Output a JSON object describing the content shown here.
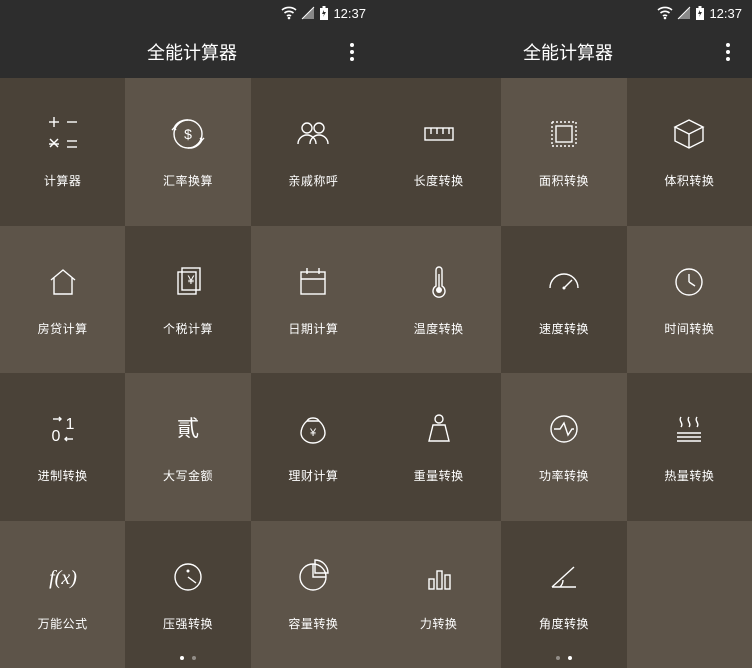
{
  "status": {
    "time": "12:37"
  },
  "app": {
    "title": "全能计算器"
  },
  "screens": [
    {
      "page_index": 0,
      "tiles": [
        {
          "id": "calculator",
          "label": "计算器",
          "icon": "calc"
        },
        {
          "id": "currency",
          "label": "汇率换算",
          "icon": "currency"
        },
        {
          "id": "kinship",
          "label": "亲戚称呼",
          "icon": "people"
        },
        {
          "id": "mortgage",
          "label": "房贷计算",
          "icon": "house"
        },
        {
          "id": "tax",
          "label": "个税计算",
          "icon": "tax"
        },
        {
          "id": "date",
          "label": "日期计算",
          "icon": "calendar"
        },
        {
          "id": "radix",
          "label": "进制转换",
          "icon": "radix"
        },
        {
          "id": "capital",
          "label": "大写金额",
          "icon": "capital"
        },
        {
          "id": "finance",
          "label": "理财计算",
          "icon": "moneybag"
        },
        {
          "id": "formula",
          "label": "万能公式",
          "icon": "fx"
        },
        {
          "id": "pressure",
          "label": "压强转换",
          "icon": "gauge"
        },
        {
          "id": "volume-cap",
          "label": "容量转换",
          "icon": "pie"
        }
      ]
    },
    {
      "page_index": 1,
      "tiles": [
        {
          "id": "length",
          "label": "长度转换",
          "icon": "ruler"
        },
        {
          "id": "area",
          "label": "面积转换",
          "icon": "area"
        },
        {
          "id": "volume",
          "label": "体积转换",
          "icon": "cube"
        },
        {
          "id": "temp",
          "label": "温度转换",
          "icon": "thermo"
        },
        {
          "id": "speed",
          "label": "速度转换",
          "icon": "speed"
        },
        {
          "id": "time",
          "label": "时间转换",
          "icon": "clock"
        },
        {
          "id": "weight",
          "label": "重量转换",
          "icon": "weight"
        },
        {
          "id": "power",
          "label": "功率转换",
          "icon": "power"
        },
        {
          "id": "heat",
          "label": "热量转换",
          "icon": "heat"
        },
        {
          "id": "force",
          "label": "力转换",
          "icon": "force"
        },
        {
          "id": "angle",
          "label": "角度转换",
          "icon": "angle"
        },
        {
          "id": "_blank",
          "label": "",
          "icon": ""
        }
      ]
    }
  ]
}
